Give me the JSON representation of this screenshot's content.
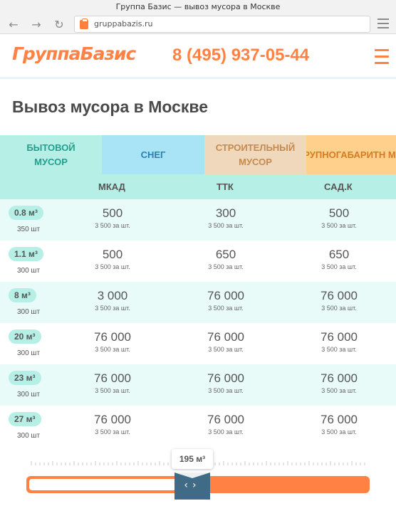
{
  "browser": {
    "title": "Группа Базис — вывоз мусора в Москве",
    "url": "gruppabazis.ru"
  },
  "header": {
    "logo": "ГруппаБазис",
    "phone": "8 (495) 937-05-44"
  },
  "page_title": "Вывоз мусора в Москве",
  "tabs": [
    {
      "label": "БЫТОВОЙ\nМУСОР"
    },
    {
      "label": "СНЕГ"
    },
    {
      "label": "СТРОИТЕЛЬНЫЙ\nМУСОР"
    },
    {
      "label": "КРУПНОГАБАРИТН\nМУСОР"
    }
  ],
  "columns": [
    "МКАД",
    "ТТК",
    "САД.К"
  ],
  "rows": [
    {
      "volume": "0.8 м³",
      "count": "350 шт",
      "prices": [
        "500",
        "300",
        "500"
      ],
      "per": "3 500 за шт."
    },
    {
      "volume": "1.1 м³",
      "count": "300 шт",
      "prices": [
        "500",
        "650",
        "650"
      ],
      "per": "3 500 за шт."
    },
    {
      "volume": "8 м³",
      "count": "300 шт",
      "prices": [
        "3 000",
        "76 000",
        "76 000"
      ],
      "per": "3 500 за шт."
    },
    {
      "volume": "20 м³",
      "count": "300 шт",
      "prices": [
        "76 000",
        "76 000",
        "76 000"
      ],
      "per": "3 500 за шт."
    },
    {
      "volume": "23 м³",
      "count": "300 шт",
      "prices": [
        "76 000",
        "76 000",
        "76 000"
      ],
      "per": "3 500 за шт."
    },
    {
      "volume": "27 м³",
      "count": "300 шт",
      "prices": [
        "76 000",
        "76 000",
        "76 000"
      ],
      "per": "3 500 за шт."
    }
  ],
  "slider": {
    "value_label": "195 м³",
    "fill_fraction": 0.45
  }
}
